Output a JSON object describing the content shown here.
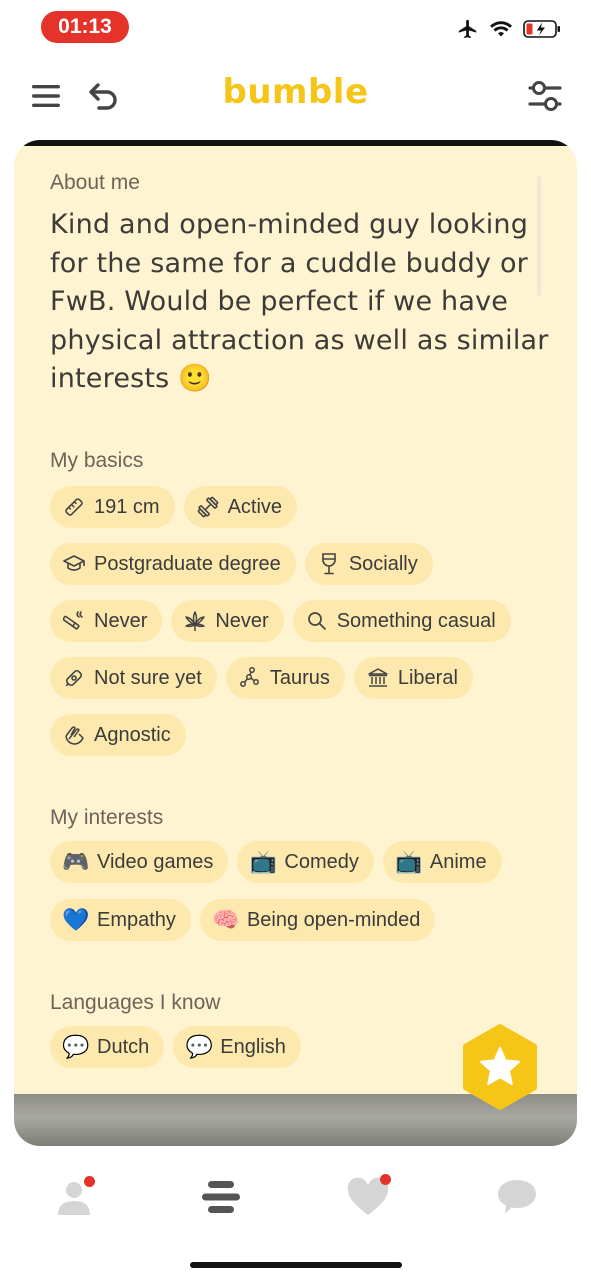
{
  "status": {
    "time": "01:13"
  },
  "header": {
    "brand": "bumble"
  },
  "about": {
    "title": "About me",
    "text": "Kind and open-minded guy looking for the same for a cuddle buddy or FwB. Would be perfect if we have physical attraction as well as similar interests 🙂"
  },
  "basics": {
    "title": "My basics",
    "chips": [
      {
        "label": "191 cm",
        "icon": "ruler-icon"
      },
      {
        "label": "Active",
        "icon": "dumbbell-icon"
      },
      {
        "label": "Postgraduate degree",
        "icon": "graduation-cap-icon"
      },
      {
        "label": "Socially",
        "icon": "wine-glass-icon"
      },
      {
        "label": "Never",
        "icon": "smoking-icon"
      },
      {
        "label": "Never",
        "icon": "cannabis-leaf-icon"
      },
      {
        "label": "Something casual",
        "icon": "search-icon"
      },
      {
        "label": "Not sure yet",
        "icon": "pacifier-icon"
      },
      {
        "label": "Taurus",
        "icon": "constellation-icon"
      },
      {
        "label": "Liberal",
        "icon": "government-building-icon"
      },
      {
        "label": "Agnostic",
        "icon": "praying-hands-icon"
      }
    ]
  },
  "interests": {
    "title": "My interests",
    "chips": [
      {
        "label": "Video games",
        "emoji": "🎮"
      },
      {
        "label": "Comedy",
        "emoji": "📺"
      },
      {
        "label": "Anime",
        "emoji": "📺"
      },
      {
        "label": "Empathy",
        "emoji": "💙"
      },
      {
        "label": "Being open-minded",
        "emoji": "🧠"
      }
    ]
  },
  "languages": {
    "title": "Languages I know",
    "chips": [
      {
        "label": "Dutch",
        "emoji": "💬"
      },
      {
        "label": "English",
        "emoji": "💬"
      }
    ]
  },
  "colors": {
    "brand": "#f5c518",
    "card_bg": "#fff4d1",
    "chip_bg": "#fde9ad",
    "notification": "#e5332a"
  }
}
